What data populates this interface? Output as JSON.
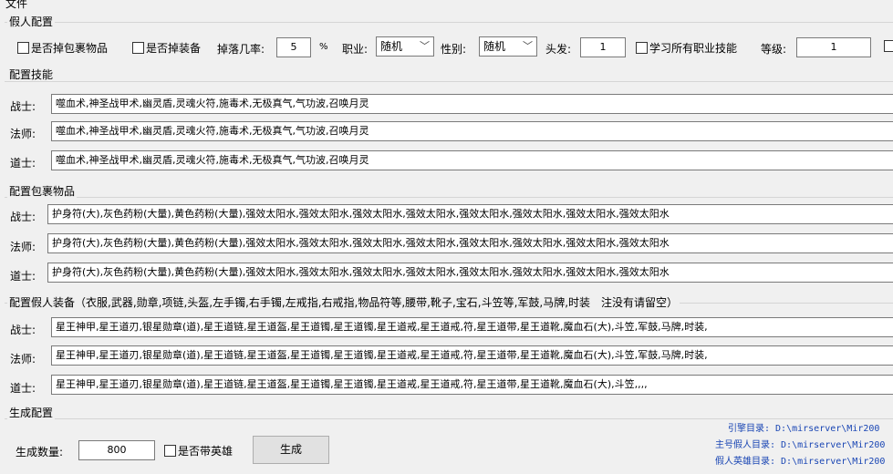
{
  "menu": {
    "file": "文件"
  },
  "bot_config": {
    "title": "假人配置",
    "drop_bag_label": "是否掉包裹物品",
    "drop_equip_label": "是否掉装备",
    "drop_rate_label": "掉落几率:",
    "drop_rate_value": "5",
    "percent": "%",
    "job_label": "职业:",
    "job_value": "随机",
    "gender_label": "性别:",
    "gender_value": "随机",
    "hair_label": "头发:",
    "hair_value": "1",
    "learn_all_label": "学习所有职业技能",
    "level_label": "等级:",
    "level_value": "1"
  },
  "skills": {
    "title": "配置技能",
    "rows": [
      {
        "label": "战士:",
        "value": "噬血术,神圣战甲术,幽灵盾,灵魂火符,施毒术,无极真气,气功波,召唤月灵"
      },
      {
        "label": "法师:",
        "value": "噬血术,神圣战甲术,幽灵盾,灵魂火符,施毒术,无极真气,气功波,召唤月灵"
      },
      {
        "label": "道士:",
        "value": "噬血术,神圣战甲术,幽灵盾,灵魂火符,施毒术,无极真气,气功波,召唤月灵"
      }
    ]
  },
  "bag": {
    "title": "配置包裹物品",
    "rows": [
      {
        "label": "战士:",
        "value": "护身符(大),灰色药粉(大量),黄色药粉(大量),强效太阳水,强效太阳水,强效太阳水,强效太阳水,强效太阳水,强效太阳水,强效太阳水,强效太阳水"
      },
      {
        "label": "法师:",
        "value": "护身符(大),灰色药粉(大量),黄色药粉(大量),强效太阳水,强效太阳水,强效太阳水,强效太阳水,强效太阳水,强效太阳水,强效太阳水,强效太阳水"
      },
      {
        "label": "道士:",
        "value": "护身符(大),灰色药粉(大量),黄色药粉(大量),强效太阳水,强效太阳水,强效太阳水,强效太阳水,强效太阳水,强效太阳水,强效太阳水,强效太阳水"
      }
    ]
  },
  "equip": {
    "title": "配置假人装备（衣服,武器,勋章,项链,头盔,左手镯,右手镯,左戒指,右戒指,物品符等,腰带,靴子,宝石,斗笠等,军鼓,马牌,时装　注没有请留空）",
    "rows": [
      {
        "label": "战士:",
        "value": "星王神甲,星王道刃,银星勋章(道),星王道链,星王道盔,星王道镯,星王道镯,星王道戒,星王道戒,符,星王道带,星王道靴,魔血石(大),斗笠,军鼓,马牌,时装,"
      },
      {
        "label": "法师:",
        "value": "星王神甲,星王道刃,银星勋章(道),星王道链,星王道盔,星王道镯,星王道镯,星王道戒,星王道戒,符,星王道带,星王道靴,魔血石(大),斗笠,军鼓,马牌,时装,"
      },
      {
        "label": "道士:",
        "value": "星王神甲,星王道刃,银星勋章(道),星王道链,星王道盔,星王道镯,星王道镯,星王道戒,星王道戒,符,星王道带,星王道靴,魔血石(大),斗笠,,,,"
      }
    ]
  },
  "generate": {
    "title": "生成配置",
    "count_label": "生成数量:",
    "count_value": "800",
    "with_hero_label": "是否带英雄",
    "generate_button": "生成",
    "engine_dir": "引擎目录: D:\\mirserver\\Mir200",
    "main_bot_dir": "主号假人目录: D:\\mirserver\\Mir200",
    "hero_bot_dir": "假人英雄目录: D:\\mirserver\\Mir200"
  }
}
